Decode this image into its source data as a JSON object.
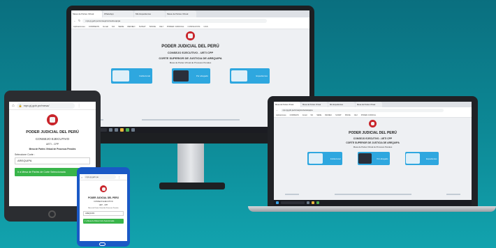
{
  "desktop": {
    "tabs": [
      "Mesa de Partes Virtual",
      "WhatsApp",
      "Mis Expedientes",
      "Mesa de Partes Virtual"
    ],
    "url": "mpv.pj.gob.pe/consejo/corte/arequipa",
    "bookmarks": [
      "Aplicaciones",
      "CORREOS",
      "Gmail",
      "SIJ",
      "SEDE",
      "RENIEC",
      "SUNAT",
      "SINOE",
      "CEJ",
      "PODER JUDICIAL",
      "CONSULTAS",
      "CAS"
    ],
    "heading": "PODER JUDICIAL DEL PERÚ",
    "council": "CONSEJO EJECUTIVO - UETI CPP",
    "court": "CORTE SUPERIOR DE JUSTICIA DE AREQUIPA",
    "mesa": "Mesa de Partes Virtual de Procesos Penales",
    "cards": [
      "Institucional",
      "Por abogado",
      "Expedientes"
    ]
  },
  "laptop": {
    "tabs": [
      "Mesa de Partes Virtual",
      "Mesa de Partes Virtual",
      "Mis Expedientes",
      "Mesa de Partes Virtual"
    ],
    "url": "mpv.pj.gob.pe/consejo/corte/arequipa",
    "bookmarks": [
      "Aplicaciones",
      "CORREOS",
      "Gmail",
      "SIJ",
      "SEDE",
      "RENIEC",
      "SUNAT",
      "SINOE",
      "CEJ",
      "PODER JUDICIAL"
    ],
    "heading": "PODER JUDICIAL DEL PERÚ",
    "council": "CONSEJO EJECUTIVO - UETI CPP",
    "court": "CORTE SUPERIOR DE JUSTICIA DE AREQUIPA",
    "mesa": "Mesa de Partes Virtual de Procesos Penales",
    "cards": [
      "Institucional",
      "Por abogado",
      "Expedientes"
    ]
  },
  "tablet": {
    "url": "mpv.pj.gob.pe/mesa/",
    "heading": "PODER JUDICIAL DEL PERÚ",
    "council": "CONSEJO EJECUTIVO",
    "ueti": "UETI - CPP",
    "mesa": "Mesa de Partes Virtual de Procesos Penales",
    "select_label": "Seleccione Corte :",
    "select_value": "AREQUIPA",
    "button": "Ir a Mesa de Partes de Corte Seleccionada"
  },
  "phone": {
    "url": "mpv.pj.gob.pe",
    "heading": "PODER JUDICIAL DEL PERÚ",
    "council": "CONSEJO EJECUTIVO",
    "ueti": "UETI - CPP",
    "mesa": "Mesa de Partes Virtual de Procesos Penales",
    "select_value": "AREQUIPA",
    "button": "Ir a Mesa de Partes Corte Seleccionada"
  },
  "colors": {
    "background": "#0d8a97",
    "brand_red": "#c9252b",
    "card_blue": "#2ea7df",
    "button_green": "#39b54a",
    "phone_frame": "#1a59c6"
  }
}
